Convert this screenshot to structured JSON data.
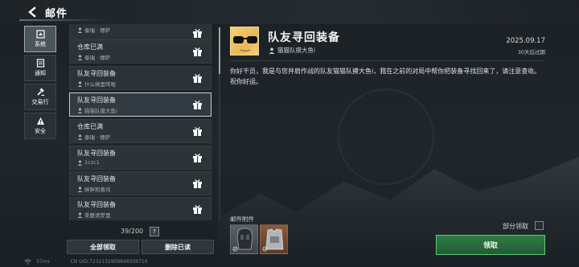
{
  "header": {
    "title": "邮件"
  },
  "sidebar": {
    "items": [
      {
        "label": "系统",
        "icon": "system-icon",
        "active": true
      },
      {
        "label": "通知",
        "icon": "notification-icon",
        "active": false
      },
      {
        "label": "交易行",
        "icon": "trade-icon",
        "active": false
      },
      {
        "label": "安全",
        "icon": "security-warning-icon",
        "active": false
      }
    ]
  },
  "mail_list": {
    "items": [
      {
        "title": "",
        "sender": "泰瑞 · 穆萨"
      },
      {
        "title": "仓库已满",
        "sender": "泰瑞 · 穆萨"
      },
      {
        "title": "队友寻回装备",
        "sender": "什么稀里哗啦"
      },
      {
        "title": "队友寻回装备",
        "sender": "猫猫队摸大鱼i",
        "selected": true
      },
      {
        "title": "仓库已满",
        "sender": "泰瑞 · 穆萨"
      },
      {
        "title": "队友寻回装备",
        "sender": "1czc1"
      },
      {
        "title": "队友寻回装备",
        "sender": "胖胖和黄鸡"
      },
      {
        "title": "队友寻回装备",
        "sender": "茶蘼清梦里"
      }
    ],
    "count": "39/200",
    "help_label": "?",
    "claim_all_label": "全部领取",
    "delete_read_label": "删除已读"
  },
  "detail": {
    "title": "队友寻回装备",
    "sender": "猫猫队摸大鱼i",
    "date": "2025.09.17",
    "expire": "30天后过期",
    "body": "你好干员，我是与您并肩作战的队友猫猫队摸大鱼i，我在之前的对局中帮你把装备寻找回来了，请注意查收。祝你好运。",
    "attachments_label": "邮件附件",
    "partial_claim_label": "部分领取",
    "claim_label": "领取"
  },
  "status": {
    "ping": "37ms",
    "uid": "CN UID:7232132909846009716"
  },
  "colors": {
    "accent_green": "#2f7a45",
    "accent_green_border": "#5ec97a",
    "panel": "#2e353a"
  }
}
